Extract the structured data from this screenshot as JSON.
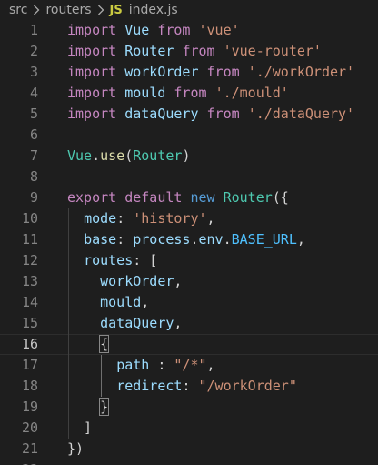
{
  "breadcrumb": {
    "folder_src": "src",
    "folder_routers": "routers",
    "file_badge": "JS",
    "file_name": "index.js"
  },
  "current_line": 16,
  "lines": [
    {
      "n": "1",
      "tokens": [
        [
          "kc",
          "import"
        ],
        [
          "p",
          " "
        ],
        [
          "v",
          "Vue"
        ],
        [
          "p",
          " "
        ],
        [
          "kc",
          "from"
        ],
        [
          "p",
          " "
        ],
        [
          "s",
          "'vue'"
        ]
      ]
    },
    {
      "n": "2",
      "tokens": [
        [
          "kc",
          "import"
        ],
        [
          "p",
          " "
        ],
        [
          "v",
          "Router"
        ],
        [
          "p",
          " "
        ],
        [
          "kc",
          "from"
        ],
        [
          "p",
          " "
        ],
        [
          "s",
          "'vue-router'"
        ]
      ]
    },
    {
      "n": "3",
      "tokens": [
        [
          "kc",
          "import"
        ],
        [
          "p",
          " "
        ],
        [
          "v",
          "workOrder"
        ],
        [
          "p",
          " "
        ],
        [
          "kc",
          "from"
        ],
        [
          "p",
          " "
        ],
        [
          "s",
          "'./workOrder'"
        ]
      ]
    },
    {
      "n": "4",
      "tokens": [
        [
          "kc",
          "import"
        ],
        [
          "p",
          " "
        ],
        [
          "v",
          "mould"
        ],
        [
          "p",
          " "
        ],
        [
          "kc",
          "from"
        ],
        [
          "p",
          " "
        ],
        [
          "s",
          "'./mould'"
        ]
      ]
    },
    {
      "n": "5",
      "tokens": [
        [
          "kc",
          "import"
        ],
        [
          "p",
          " "
        ],
        [
          "v",
          "dataQuery"
        ],
        [
          "p",
          " "
        ],
        [
          "kc",
          "from"
        ],
        [
          "p",
          " "
        ],
        [
          "s",
          "'./dataQuery'"
        ]
      ]
    },
    {
      "n": "6",
      "tokens": []
    },
    {
      "n": "7",
      "tokens": [
        [
          "t",
          "Vue"
        ],
        [
          "p",
          "."
        ],
        [
          "f",
          "use"
        ],
        [
          "p",
          "("
        ],
        [
          "t",
          "Router"
        ],
        [
          "p",
          ")"
        ]
      ]
    },
    {
      "n": "8",
      "tokens": []
    },
    {
      "n": "9",
      "tokens": [
        [
          "kc",
          "export"
        ],
        [
          "p",
          " "
        ],
        [
          "kc",
          "default"
        ],
        [
          "p",
          " "
        ],
        [
          "k",
          "new"
        ],
        [
          "p",
          " "
        ],
        [
          "t",
          "Router"
        ],
        [
          "p",
          "({"
        ]
      ]
    },
    {
      "n": "10",
      "tokens": [
        [
          "p",
          "  "
        ],
        [
          "v",
          "mode"
        ],
        [
          "p",
          ": "
        ],
        [
          "s",
          "'history'"
        ],
        [
          "p",
          ","
        ]
      ]
    },
    {
      "n": "11",
      "tokens": [
        [
          "p",
          "  "
        ],
        [
          "v",
          "base"
        ],
        [
          "p",
          ": "
        ],
        [
          "v",
          "process"
        ],
        [
          "p",
          "."
        ],
        [
          "v",
          "env"
        ],
        [
          "p",
          "."
        ],
        [
          "c",
          "BASE_URL"
        ],
        [
          "p",
          ","
        ]
      ]
    },
    {
      "n": "12",
      "tokens": [
        [
          "p",
          "  "
        ],
        [
          "v",
          "routes"
        ],
        [
          "p",
          ": ["
        ]
      ]
    },
    {
      "n": "13",
      "tokens": [
        [
          "p",
          "    "
        ],
        [
          "v",
          "workOrder"
        ],
        [
          "p",
          ","
        ]
      ]
    },
    {
      "n": "14",
      "tokens": [
        [
          "p",
          "    "
        ],
        [
          "v",
          "mould"
        ],
        [
          "p",
          ","
        ]
      ]
    },
    {
      "n": "15",
      "tokens": [
        [
          "p",
          "    "
        ],
        [
          "v",
          "dataQuery"
        ],
        [
          "p",
          ","
        ]
      ]
    },
    {
      "n": "16",
      "tokens": [
        [
          "p",
          "    "
        ],
        [
          "pm",
          "{"
        ]
      ]
    },
    {
      "n": "17",
      "tokens": [
        [
          "p",
          "      "
        ],
        [
          "v",
          "path"
        ],
        [
          "p",
          " : "
        ],
        [
          "s",
          "\"/*\""
        ],
        [
          "p",
          ","
        ]
      ]
    },
    {
      "n": "18",
      "tokens": [
        [
          "p",
          "      "
        ],
        [
          "v",
          "redirect"
        ],
        [
          "p",
          ": "
        ],
        [
          "s",
          "\"/workOrder\""
        ]
      ]
    },
    {
      "n": "19",
      "tokens": [
        [
          "p",
          "    "
        ],
        [
          "pm",
          "}"
        ]
      ]
    },
    {
      "n": "20",
      "tokens": [
        [
          "p",
          "  ]"
        ]
      ]
    },
    {
      "n": "21",
      "tokens": [
        [
          "p",
          "})"
        ]
      ]
    },
    {
      "n": "22",
      "tokens": []
    }
  ],
  "colors": {
    "background": "#1e1e1e",
    "line_number": "#858585",
    "line_number_active": "#c6c6c6",
    "keyword_control": "#c586c0",
    "keyword": "#569cd6",
    "variable": "#9cdcfe",
    "function": "#dcdcaa",
    "type": "#4ec9b0",
    "string": "#ce9178",
    "constant": "#4fc1ff",
    "js_badge": "#cbcb41"
  }
}
